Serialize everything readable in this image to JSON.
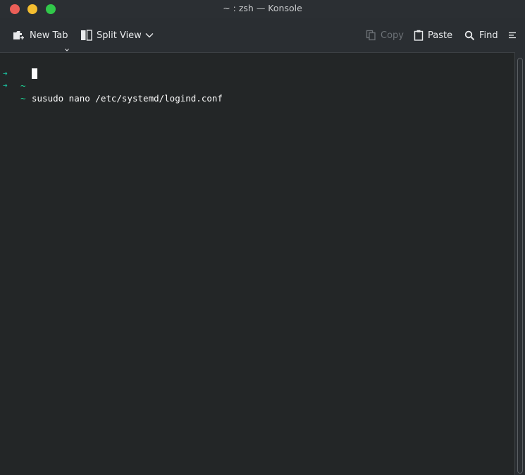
{
  "window": {
    "title": "~ : zsh — Konsole",
    "traffic_lights": {
      "close": "#ec5f58",
      "minimize": "#f4be30",
      "maximize": "#31c84a"
    }
  },
  "toolbar": {
    "new_tab_label": "New Tab",
    "split_view_label": "Split View",
    "copy_label": "Copy",
    "paste_label": "Paste",
    "find_label": "Find",
    "icons": {
      "new_tab": "new-tab-icon",
      "split_view": "split-view-icon",
      "dropdown": "chevron-down-icon",
      "copy": "copy-icon",
      "paste": "paste-icon",
      "find": "search-icon",
      "menu": "hamburger-menu-icon"
    }
  },
  "terminal": {
    "lines": [
      {
        "arrow": "➜",
        "dir": "~",
        "command": "susudo nano /etc/systemd/logind.conf"
      },
      {
        "arrow": "➜",
        "dir": "~",
        "command": ""
      }
    ],
    "colors": {
      "background": "#232627",
      "prompt": "#1abc9c",
      "text": "#fcfcfc"
    }
  }
}
